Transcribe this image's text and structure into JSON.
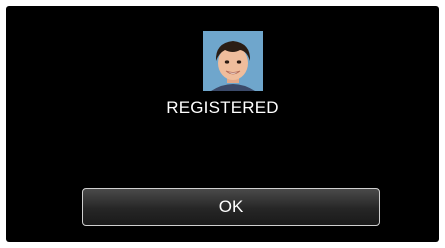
{
  "dialog": {
    "status_text": "REGISTERED",
    "ok_label": "OK"
  },
  "photo": {
    "icon": "registered-face-photo"
  },
  "colors": {
    "background": "#000000",
    "text": "#ffffff",
    "button_border": "#cfcfcf"
  }
}
